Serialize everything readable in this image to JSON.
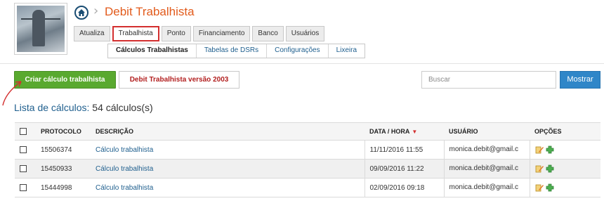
{
  "header": {
    "title": "Debit Trabalhista"
  },
  "tabs": [
    {
      "label": "Atualiza",
      "active": false
    },
    {
      "label": "Trabalhista",
      "active": true
    },
    {
      "label": "Ponto",
      "active": false
    },
    {
      "label": "Financiamento",
      "active": false
    },
    {
      "label": "Banco",
      "active": false
    },
    {
      "label": "Usuários",
      "active": false
    }
  ],
  "subtabs": [
    {
      "label": "Cálculos Trabalhistas",
      "active": true
    },
    {
      "label": "Tabelas de DSRs",
      "active": false
    },
    {
      "label": "Configurações",
      "active": false
    },
    {
      "label": "Lixeira",
      "active": false
    }
  ],
  "toolbar": {
    "create_label": "Criar cálculo trabalhista",
    "legacy_label": "Debit Trabalhista versão 2003",
    "search_placeholder": "Buscar",
    "search_button": "Mostrar"
  },
  "list": {
    "title_prefix": "Lista de cálculos:",
    "title_count": "54 cálculos(s)"
  },
  "table": {
    "columns": {
      "protocolo": "PROTOCOLO",
      "descricao": "DESCRIÇÃO",
      "data_hora": "DATA / HORA",
      "usuario": "USUÁRIO",
      "opcoes": "OPÇÕES"
    },
    "rows": [
      {
        "protocolo": "15506374",
        "descricao": "Cálculo trabalhista",
        "data_hora": "11/11/2016 11:55",
        "usuario": "monica.debit@gmail.c"
      },
      {
        "protocolo": "15450933",
        "descricao": "Cálculo trabalhista",
        "data_hora": "09/09/2016 11:22",
        "usuario": "monica.debit@gmail.c"
      },
      {
        "protocolo": "15444998",
        "descricao": "Cálculo trabalhista",
        "data_hora": "02/09/2016 09:18",
        "usuario": "monica.debit@gmail.c"
      }
    ]
  },
  "colors": {
    "accent_orange": "#e25b1c",
    "primary_green": "#59a92f",
    "primary_blue": "#2f86c8",
    "legacy_red": "#b21f1f",
    "link_blue": "#1f5f8e",
    "highlight_red": "#d32f2f"
  }
}
